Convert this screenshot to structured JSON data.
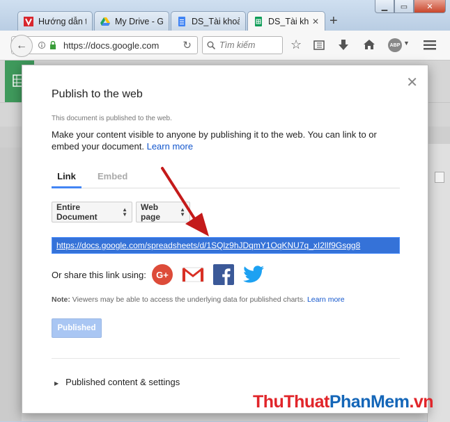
{
  "browser": {
    "tabs": [
      {
        "label": "Hướng dẫn t"
      },
      {
        "label": "My Drive - G"
      },
      {
        "label": "DS_Tài khoản"
      },
      {
        "label": "DS_Tài kh"
      }
    ],
    "url": "https://docs.google.com",
    "search_placeholder": "Tìm kiếm",
    "abp_label": "ABP"
  },
  "dialog": {
    "title": "Publish to the web",
    "status": "This document is published to the web.",
    "description": "Make your content visible to anyone by publishing it to the web. You can link to or embed your document.",
    "learn_more": "Learn more",
    "tab_link": "Link",
    "tab_embed": "Embed",
    "select_scope": "Entire Document",
    "select_format": "Web page",
    "published_url": "https://docs.google.com/spreadsheets/d/1SQlz9hJDqmY1OqKNU7q_xI2lIf9Gsgg8",
    "share_label": "Or share this link using:",
    "note_label": "Note:",
    "note_text": " Viewers may be able to access the underlying data for published charts.",
    "note_learn_more": "Learn more",
    "published_button": "Published",
    "settings_label": "Published content & settings"
  },
  "watermark": {
    "part1": "ThuThuat",
    "part2": "PhanMem",
    "part3": ".vn"
  },
  "colors": {
    "accent": "#4285f4",
    "link": "#1155cc",
    "selected_bg": "#3572d8",
    "arrow": "#c41a1a"
  }
}
